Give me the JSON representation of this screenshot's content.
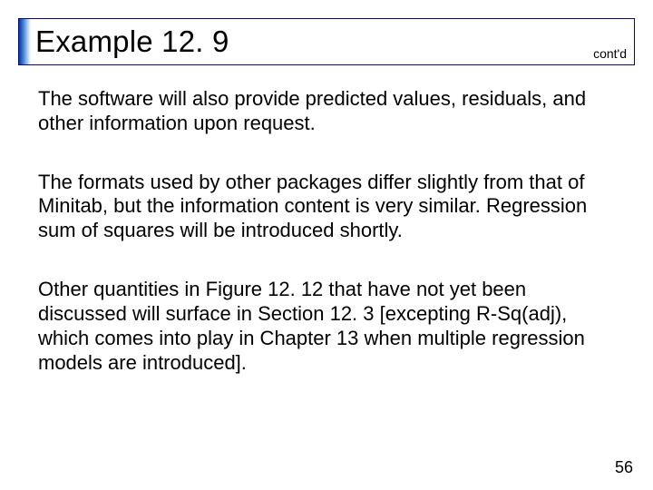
{
  "title": "Example 12. 9",
  "contd": "cont'd",
  "paragraphs": {
    "p1": "The software will also provide predicted values, residuals, and other information upon request.",
    "p2": "The formats used by other packages differ slightly from that of Minitab, but the information content is very similar. Regression sum of squares will be introduced shortly.",
    "p3": "Other quantities in Figure 12. 12 that have not yet been discussed will surface in Section 12. 3 [excepting R‑Sq(adj), which comes into play in Chapter 13 when multiple regression models are introduced]."
  },
  "page_number": "56"
}
